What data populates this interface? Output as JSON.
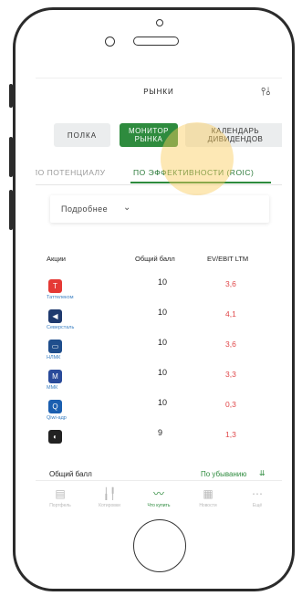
{
  "header": {
    "title": "РЫНКИ",
    "filter_icon": "filter-sliders-icon"
  },
  "segments": [
    {
      "label": "ПОЛКА",
      "active": false
    },
    {
      "label": "МОНИТОР\nРЫНКА",
      "active": true
    },
    {
      "label": "КАЛЕНДАРЬ\nДИВИДЕНДОВ",
      "active": false
    }
  ],
  "tabs": [
    {
      "label": "ПО ПОТЕНЦИАЛУ",
      "active": false
    },
    {
      "label": "ПО ЭФФЕКТИВНОСТИ (ROIC)",
      "active": true
    }
  ],
  "dropdown": {
    "label": "Подробнее",
    "icon": "chevron-down-icon"
  },
  "table": {
    "columns": [
      "Акции",
      "Общий балл",
      "EV/EBIT LTM"
    ],
    "rows": [
      {
        "name": "Таттелеком",
        "score": "10",
        "ev_ebit": "3,6",
        "logo_color": "#e53935"
      },
      {
        "name": "Северсталь",
        "score": "10",
        "ev_ebit": "4,1",
        "logo_color": "#1f3a6e"
      },
      {
        "name": "НЛМК",
        "score": "10",
        "ev_ebit": "3,6",
        "logo_color": "#1f4e8c"
      },
      {
        "name": "ММК",
        "score": "10",
        "ev_ebit": "3,3",
        "logo_color": "#2a4b9b"
      },
      {
        "name": "Qiwi-адр",
        "score": "10",
        "ev_ebit": "0,3",
        "logo_color": "#1b5fb0"
      },
      {
        "name": "",
        "score": "9",
        "ev_ebit": "1,3",
        "logo_color": "#222222"
      }
    ]
  },
  "footer": {
    "label": "Общий балл",
    "sort": "По убыванию",
    "sort_icon": "sort-icon"
  },
  "bottom_nav": [
    {
      "label": "Портфель",
      "icon": "portfolio-icon",
      "active": false
    },
    {
      "label": "Котировки",
      "icon": "quotes-icon",
      "active": false
    },
    {
      "label": "Что купить",
      "icon": "chart-line-icon",
      "active": true
    },
    {
      "label": "Новости",
      "icon": "news-icon",
      "active": false
    },
    {
      "label": "Ещё",
      "icon": "more-icon",
      "active": false
    }
  ],
  "colors": {
    "accent": "#2e8b3e",
    "value_red": "#e0484a",
    "highlight": "#facd5a"
  }
}
